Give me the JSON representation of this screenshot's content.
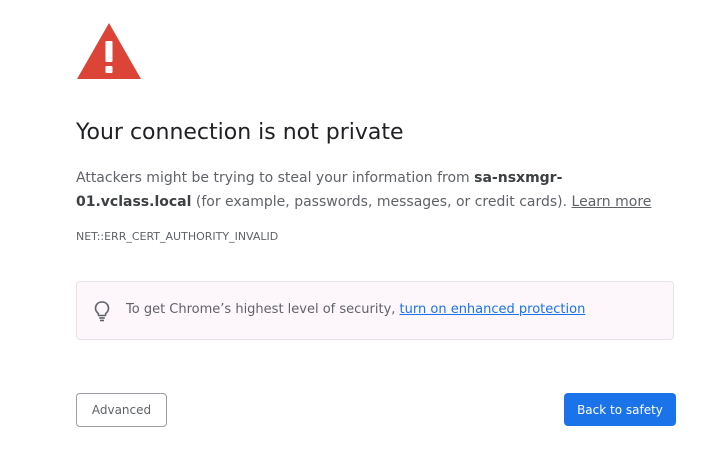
{
  "icons": {
    "warning": "warning-triangle-icon",
    "tip": "lightbulb-icon"
  },
  "colors": {
    "warning_red": "#db4437",
    "primary_blue": "#1a73e8",
    "text_gray": "#5f6368"
  },
  "interstitial": {
    "title": "Your connection is not private",
    "message_before": "Attackers might be trying to steal your information from ",
    "host": "sa-nsxmgr-01.vclass.local",
    "message_after": " (for example, passwords, messages, or credit cards). ",
    "learn_more": "Learn more",
    "error_code": "NET::ERR_CERT_AUTHORITY_INVALID"
  },
  "enhanced_protection": {
    "text": "To get Chrome’s highest level of security, ",
    "link": "turn on enhanced protection"
  },
  "buttons": {
    "advanced": "Advanced",
    "back_to_safety": "Back to safety"
  }
}
